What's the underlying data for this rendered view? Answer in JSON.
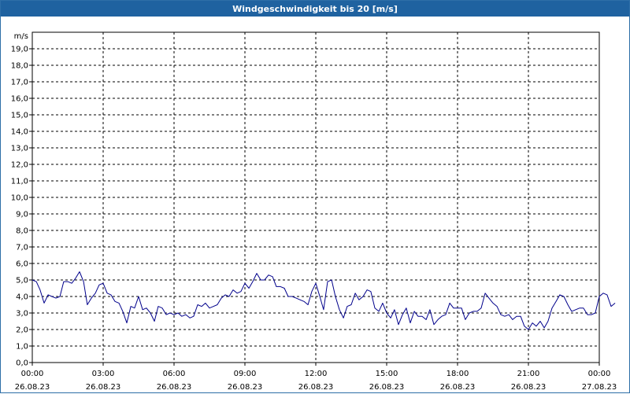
{
  "chart_data": {
    "type": "line",
    "title": "Windgeschwindigkeit bis 20 [m/s]",
    "ylabel": "m/s",
    "xlabel": "",
    "ylim": [
      0,
      20
    ],
    "grid": true,
    "y_ticks": [
      "0,0",
      "1,0",
      "2,0",
      "3,0",
      "4,0",
      "5,0",
      "6,0",
      "7,0",
      "8,0",
      "9,0",
      "10,0",
      "11,0",
      "12,0",
      "13,0",
      "14,0",
      "15,0",
      "16,0",
      "17,0",
      "18,0",
      "19,0"
    ],
    "x_ticks": [
      {
        "time": "00:00",
        "date": "26.08.23"
      },
      {
        "time": "03:00",
        "date": "26.08.23"
      },
      {
        "time": "06:00",
        "date": "26.08.23"
      },
      {
        "time": "09:00",
        "date": "26.08.23"
      },
      {
        "time": "12:00",
        "date": "26.08.23"
      },
      {
        "time": "15:00",
        "date": "26.08.23"
      },
      {
        "time": "18:00",
        "date": "26.08.23"
      },
      {
        "time": "21:00",
        "date": "26.08.23"
      },
      {
        "time": "00:00",
        "date": "27.08.23"
      }
    ],
    "series": [
      {
        "color": "#00008b",
        "x_unit": "hours since 26.08.23 00:00",
        "points": [
          [
            0.0,
            5.0
          ],
          [
            0.17,
            4.9
          ],
          [
            0.33,
            4.4
          ],
          [
            0.5,
            3.6
          ],
          [
            0.67,
            4.1
          ],
          [
            0.83,
            4.0
          ],
          [
            1.0,
            3.9
          ],
          [
            1.17,
            4.0
          ],
          [
            1.33,
            4.9
          ],
          [
            1.5,
            4.9
          ],
          [
            1.67,
            4.8
          ],
          [
            1.83,
            5.1
          ],
          [
            2.0,
            5.5
          ],
          [
            2.17,
            4.9
          ],
          [
            2.33,
            3.5
          ],
          [
            2.5,
            3.9
          ],
          [
            2.67,
            4.2
          ],
          [
            2.83,
            4.7
          ],
          [
            3.0,
            4.8
          ],
          [
            3.17,
            4.2
          ],
          [
            3.33,
            4.1
          ],
          [
            3.5,
            3.7
          ],
          [
            3.67,
            3.6
          ],
          [
            3.83,
            3.1
          ],
          [
            4.0,
            2.4
          ],
          [
            4.17,
            3.4
          ],
          [
            4.33,
            3.3
          ],
          [
            4.5,
            4.0
          ],
          [
            4.67,
            3.2
          ],
          [
            4.83,
            3.3
          ],
          [
            5.0,
            3.0
          ],
          [
            5.17,
            2.5
          ],
          [
            5.33,
            3.4
          ],
          [
            5.5,
            3.3
          ],
          [
            5.67,
            2.9
          ],
          [
            5.83,
            3.0
          ],
          [
            6.0,
            2.9
          ],
          [
            6.17,
            3.0
          ],
          [
            6.33,
            2.8
          ],
          [
            6.5,
            2.9
          ],
          [
            6.67,
            2.7
          ],
          [
            6.83,
            2.8
          ],
          [
            7.0,
            3.5
          ],
          [
            7.17,
            3.4
          ],
          [
            7.33,
            3.6
          ],
          [
            7.5,
            3.3
          ],
          [
            7.67,
            3.4
          ],
          [
            7.83,
            3.5
          ],
          [
            8.0,
            3.9
          ],
          [
            8.17,
            4.1
          ],
          [
            8.33,
            4.0
          ],
          [
            8.5,
            4.4
          ],
          [
            8.67,
            4.2
          ],
          [
            8.83,
            4.3
          ],
          [
            9.0,
            4.8
          ],
          [
            9.17,
            4.5
          ],
          [
            9.33,
            4.9
          ],
          [
            9.5,
            5.4
          ],
          [
            9.67,
            5.0
          ],
          [
            9.83,
            5.0
          ],
          [
            10.0,
            5.3
          ],
          [
            10.17,
            5.2
          ],
          [
            10.33,
            4.6
          ],
          [
            10.5,
            4.6
          ],
          [
            10.67,
            4.5
          ],
          [
            10.83,
            4.0
          ],
          [
            11.0,
            4.0
          ],
          [
            11.17,
            3.9
          ],
          [
            11.33,
            3.8
          ],
          [
            11.5,
            3.7
          ],
          [
            11.67,
            3.5
          ],
          [
            11.83,
            4.3
          ],
          [
            12.0,
            4.8
          ],
          [
            12.17,
            4.0
          ],
          [
            12.33,
            3.2
          ],
          [
            12.5,
            4.9
          ],
          [
            12.67,
            5.0
          ],
          [
            12.83,
            4.0
          ],
          [
            13.0,
            3.2
          ],
          [
            13.17,
            2.7
          ],
          [
            13.33,
            3.4
          ],
          [
            13.5,
            3.5
          ],
          [
            13.67,
            4.2
          ],
          [
            13.83,
            3.8
          ],
          [
            14.0,
            4.0
          ],
          [
            14.17,
            4.4
          ],
          [
            14.33,
            4.3
          ],
          [
            14.5,
            3.3
          ],
          [
            14.67,
            3.1
          ],
          [
            14.83,
            3.6
          ],
          [
            15.0,
            3.0
          ],
          [
            15.17,
            2.7
          ],
          [
            15.33,
            3.2
          ],
          [
            15.5,
            2.3
          ],
          [
            15.67,
            2.9
          ],
          [
            15.83,
            3.3
          ],
          [
            16.0,
            2.4
          ],
          [
            16.17,
            3.1
          ],
          [
            16.33,
            2.8
          ],
          [
            16.5,
            2.8
          ],
          [
            16.67,
            2.6
          ],
          [
            16.83,
            3.2
          ],
          [
            17.0,
            2.3
          ],
          [
            17.17,
            2.6
          ],
          [
            17.33,
            2.8
          ],
          [
            17.5,
            2.9
          ],
          [
            17.67,
            3.6
          ],
          [
            17.83,
            3.3
          ],
          [
            18.0,
            3.3
          ],
          [
            18.17,
            3.3
          ],
          [
            18.33,
            2.6
          ],
          [
            18.5,
            3.0
          ],
          [
            18.67,
            3.1
          ],
          [
            18.83,
            3.1
          ],
          [
            19.0,
            3.3
          ],
          [
            19.17,
            4.2
          ],
          [
            19.33,
            3.9
          ],
          [
            19.5,
            3.6
          ],
          [
            19.67,
            3.4
          ],
          [
            19.83,
            2.9
          ],
          [
            20.0,
            2.8
          ],
          [
            20.17,
            2.9
          ],
          [
            20.33,
            2.6
          ],
          [
            20.5,
            2.8
          ],
          [
            20.67,
            2.8
          ],
          [
            20.83,
            2.2
          ],
          [
            21.0,
            2.0
          ],
          [
            21.17,
            2.4
          ],
          [
            21.33,
            2.2
          ],
          [
            21.5,
            2.5
          ],
          [
            21.67,
            2.1
          ],
          [
            21.83,
            2.5
          ],
          [
            22.0,
            3.3
          ],
          [
            22.17,
            3.7
          ],
          [
            22.33,
            4.1
          ],
          [
            22.5,
            4.0
          ],
          [
            22.67,
            3.5
          ],
          [
            22.83,
            3.1
          ],
          [
            23.0,
            3.2
          ],
          [
            23.17,
            3.3
          ],
          [
            23.33,
            3.3
          ],
          [
            23.5,
            2.9
          ],
          [
            23.67,
            2.9
          ],
          [
            23.83,
            3.0
          ],
          [
            24.0,
            4.0
          ],
          [
            24.17,
            4.2
          ],
          [
            24.33,
            4.1
          ],
          [
            24.5,
            3.4
          ],
          [
            24.67,
            3.6
          ]
        ]
      }
    ]
  }
}
